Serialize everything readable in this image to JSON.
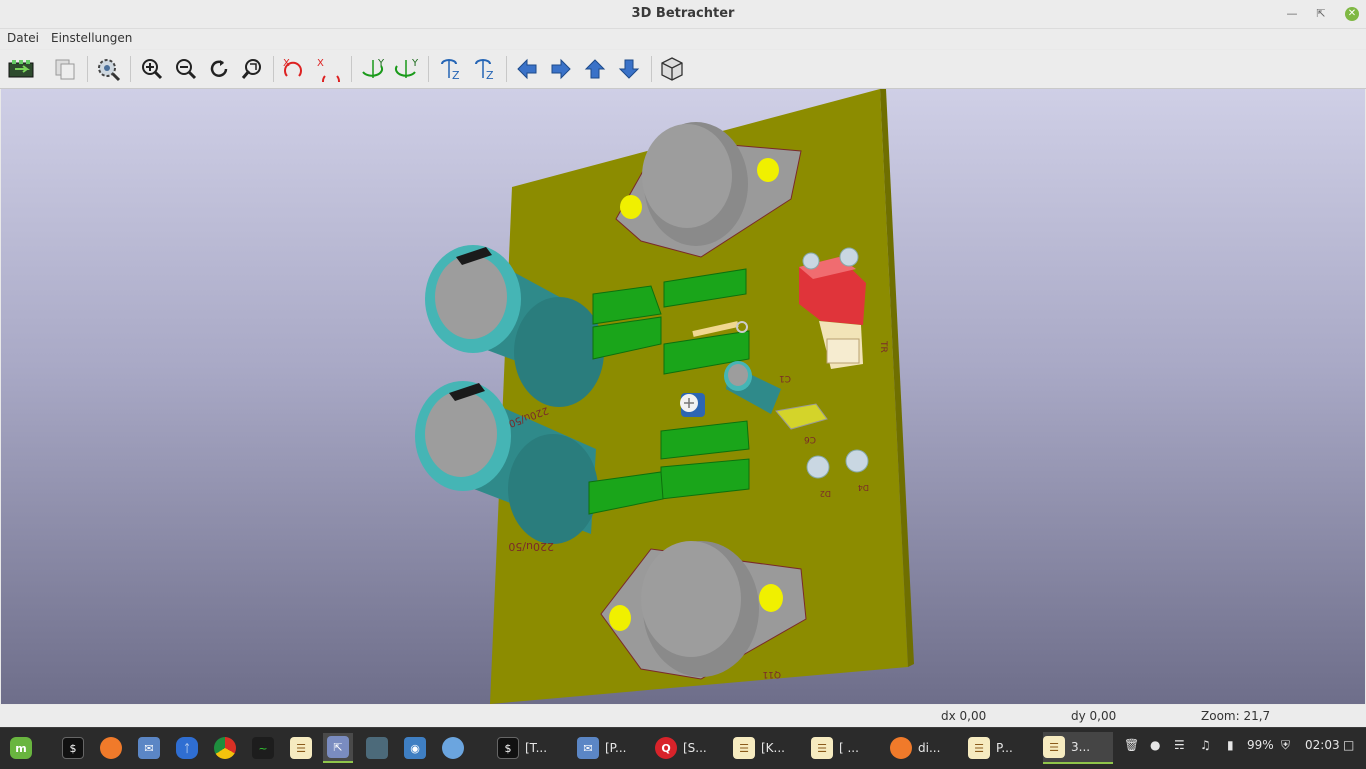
{
  "window": {
    "title": "3D Betrachter"
  },
  "menu": {
    "items": [
      "Datei",
      "Einstellungen"
    ]
  },
  "toolbar": {
    "buttons": [
      {
        "name": "reload-board-button",
        "icon": "reload-board-icon"
      },
      {
        "name": "copy-image-button",
        "icon": "copy-image-icon"
      },
      {
        "name": "settings-button",
        "icon": "gear-magnifier-icon"
      },
      {
        "name": "zoom-in-button",
        "icon": "zoom-in-icon"
      },
      {
        "name": "zoom-out-button",
        "icon": "zoom-out-icon"
      },
      {
        "name": "redraw-button",
        "icon": "refresh-icon"
      },
      {
        "name": "zoom-fit-button",
        "icon": "zoom-fit-icon"
      },
      {
        "name": "rotate-x-cw-button",
        "icon": "rotate-x-icon",
        "letter": "X"
      },
      {
        "name": "rotate-x-ccw-button",
        "icon": "rotate-x-icon",
        "letter": "X"
      },
      {
        "name": "rotate-y-cw-button",
        "icon": "rotate-y-icon",
        "letter": "Y"
      },
      {
        "name": "rotate-y-ccw-button",
        "icon": "rotate-y-icon",
        "letter": "Y"
      },
      {
        "name": "rotate-z-cw-button",
        "icon": "rotate-z-icon",
        "letter": "Z"
      },
      {
        "name": "rotate-z-ccw-button",
        "icon": "rotate-z-icon",
        "letter": "Z"
      },
      {
        "name": "move-left-button",
        "icon": "arrow-left-icon"
      },
      {
        "name": "move-right-button",
        "icon": "arrow-right-icon"
      },
      {
        "name": "move-up-button",
        "icon": "arrow-up-icon"
      },
      {
        "name": "move-down-button",
        "icon": "arrow-down-icon"
      },
      {
        "name": "ortho-view-button",
        "icon": "cube-icon"
      }
    ]
  },
  "board": {
    "silkscreen": [
      "220u/50",
      "220u/50",
      "C1",
      "C6",
      "D2",
      "D4",
      "Q11",
      "TR"
    ],
    "colors": {
      "pcb": "#8c8c00",
      "capacitor": "#2f9b9b",
      "green_part": "#1aa51a",
      "red_part": "#e0343a",
      "yellow": "#f0f000"
    }
  },
  "status": {
    "dx": "dx 0,00",
    "dy": "dy 0,00",
    "zoom": "Zoom: 21,7"
  },
  "taskbar": {
    "launchers": [
      "mint-menu-icon",
      "terminal-icon",
      "firefox-icon",
      "mail-icon",
      "bluetooth-icon",
      "chrome-icon",
      "system-monitor-icon",
      "kicad-icon",
      "screenshot-tool-icon",
      "desktop-icon",
      "camera-icon",
      "globe-icon"
    ],
    "windows": [
      {
        "icon": "terminal-icon",
        "label": "[T..."
      },
      {
        "icon": "mail-icon",
        "label": "[P..."
      },
      {
        "icon": "app-q-icon",
        "label": "[S..."
      },
      {
        "icon": "kicad-icon",
        "label": "[K..."
      },
      {
        "icon": "kicad-icon",
        "label": "[ ..."
      },
      {
        "icon": "firefox-icon",
        "label": "di..."
      },
      {
        "icon": "kicad-icon",
        "label": "P..."
      },
      {
        "icon": "kicad-icon",
        "label": "3..."
      }
    ],
    "tray": {
      "battery": "99%",
      "clock": "02:03"
    }
  }
}
